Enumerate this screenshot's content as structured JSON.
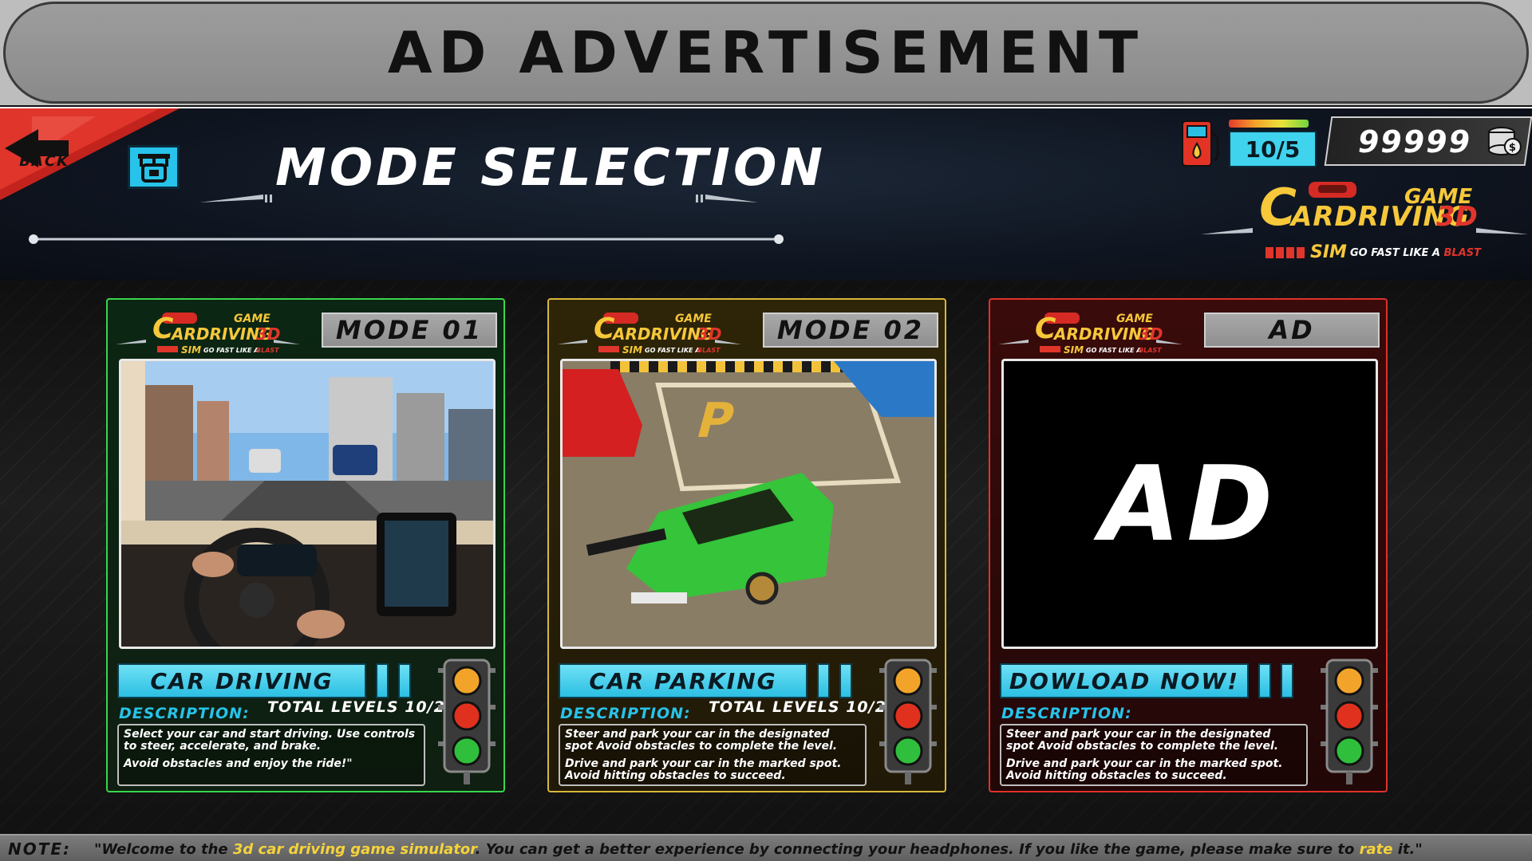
{
  "ad_banner": {
    "title": "AD ADVERTISEMENT"
  },
  "header": {
    "back_label": "BACK",
    "title": "MODE SELECTION",
    "fuel": "10/5",
    "coins": "99999",
    "brand": {
      "line1": "GAME",
      "line2a": "C",
      "line2b": "ARDRIVING",
      "line2c": "3D",
      "sim": "SIM",
      "tagline_a": "GO FAST LIKE A ",
      "tagline_b": "BLAST"
    }
  },
  "cards": [
    {
      "badge": "MODE 01",
      "action": "CAR DRIVING",
      "desc_label": "DESCRIPTION:",
      "levels": "TOTAL LEVELS 10/2",
      "desc": [
        "Select your car and start driving. Use controls to steer, accelerate, and brake.",
        "Avoid obstacles and enjoy the ride!\""
      ]
    },
    {
      "badge": "MODE 02",
      "action": "CAR PARKING",
      "desc_label": "DESCRIPTION:",
      "levels": "TOTAL LEVELS 10/2",
      "desc": [
        "Steer and park your car in the designated spot Avoid obstacles to complete the level.",
        "Drive and park your car in the marked spot. Avoid hitting obstacles to succeed."
      ]
    },
    {
      "badge": "AD",
      "ad_text": "AD",
      "action": "DOWLOAD NOW!",
      "desc_label": "DESCRIPTION:",
      "desc": [
        "Steer and park your car in the designated spot Avoid obstacles to complete the level.",
        "Drive and park your car in the marked spot. Avoid hitting obstacles to succeed."
      ]
    }
  ],
  "note": {
    "label": "NOTE:",
    "text_a": "\"Welcome to the ",
    "text_b": "3d car driving game simulator",
    "text_c": ". You can get a better experience by connecting your headphones. If you like the game, please make sure to ",
    "text_d": "rate",
    "text_e": " it.\""
  },
  "colors": {
    "accent_cyan": "#27c3ea",
    "mode1_border": "#39d64a",
    "mode2_border": "#d8b83a",
    "ad_border": "#e0312c",
    "back_red": "#d62a24"
  },
  "icons": [
    "back-arrow-icon",
    "parking-mode-icon",
    "fuel-pump-icon",
    "coins-icon",
    "traffic-light-icon"
  ]
}
